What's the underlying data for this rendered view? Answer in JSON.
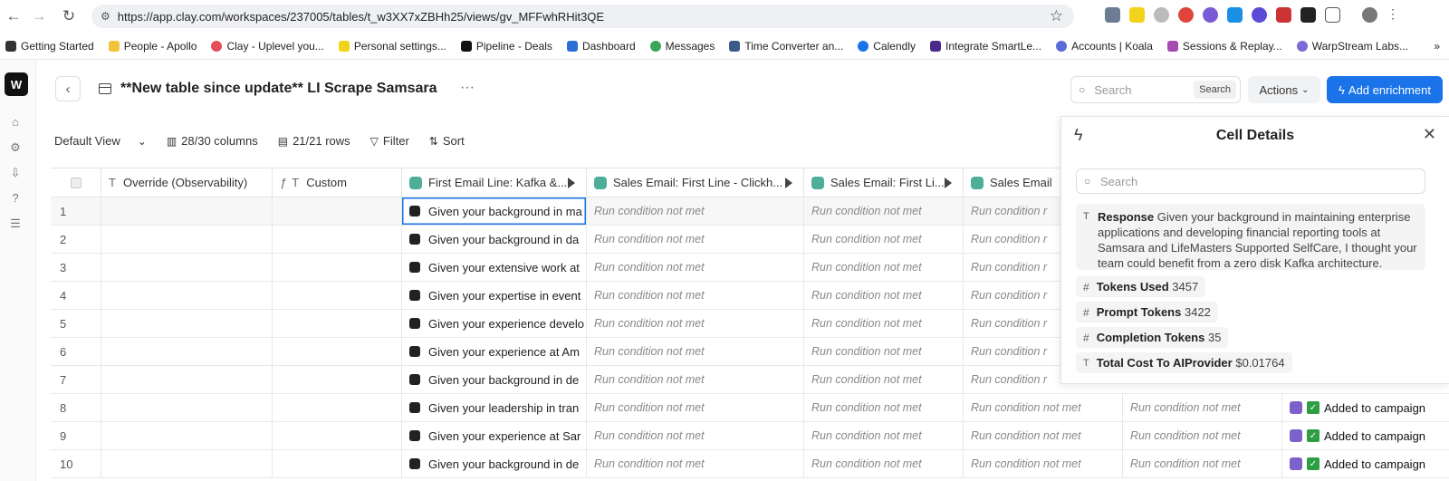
{
  "browser": {
    "url": "https://app.clay.com/workspaces/237005/tables/t_w3XX7xZBHh25/views/gv_MFFwhRHit3QE",
    "bookmarks": [
      "Getting Started",
      "People - Apollo",
      "Clay - Uplevel you...",
      "Personal settings...",
      "Pipeline - Deals",
      "Dashboard",
      "Messages",
      "Time Converter an...",
      "Calendly",
      "Integrate SmartLe...",
      "Accounts | Koala",
      "Sessions & Replay...",
      "WarpStream Labs..."
    ]
  },
  "app": {
    "logo": "W",
    "title": "**New table since update** LI Scrape Samsara",
    "search_placeholder": "Search",
    "search_button": "Search",
    "actions_label": "Actions",
    "add_enrichment_label": "Add enrichment"
  },
  "toolbar": {
    "view": "Default View",
    "columns": "28/30 columns",
    "rows": "21/21 rows",
    "filter": "Filter",
    "sort": "Sort"
  },
  "columns": {
    "c1": "Override (Observability)",
    "c2": "Custom",
    "c3": "First Email Line: Kafka &...",
    "c4": "Sales Email: First Line - Clickh...",
    "c5": "Sales Email: First Li...",
    "c6": "Sales Email"
  },
  "rows": [
    {
      "n": "1",
      "first": "Given your background in ma"
    },
    {
      "n": "2",
      "first": "Given your background in da"
    },
    {
      "n": "3",
      "first": "Given your extensive work at"
    },
    {
      "n": "4",
      "first": "Given your expertise in event"
    },
    {
      "n": "5",
      "first": "Given your experience develo"
    },
    {
      "n": "6",
      "first": "Given your experience at Am"
    },
    {
      "n": "7",
      "first": "Given your background in de"
    },
    {
      "n": "8",
      "first": "Given your leadership in tran"
    },
    {
      "n": "9",
      "first": "Given your experience at Sar"
    },
    {
      "n": "10",
      "first": "Given your background in de"
    }
  ],
  "run_condition_text": "Run condition not met",
  "run_condition_short": "Run condition r",
  "added_text": "Added to campaign",
  "panel": {
    "title": "Cell Details",
    "search_placeholder": "Search",
    "response_label": "Response",
    "response_text": "Given your background in maintaining enterprise applications and developing financial reporting tools at Samsara and LifeMasters Supported SelfCare, I thought your team could benefit from a zero disk Kafka architecture.",
    "tokens_used_label": "Tokens Used",
    "tokens_used": "3457",
    "prompt_tokens_label": "Prompt Tokens",
    "prompt_tokens": "3422",
    "completion_tokens_label": "Completion Tokens",
    "completion_tokens": "35",
    "cost_label": "Total Cost To AIProvider",
    "cost": "$0.01764"
  }
}
